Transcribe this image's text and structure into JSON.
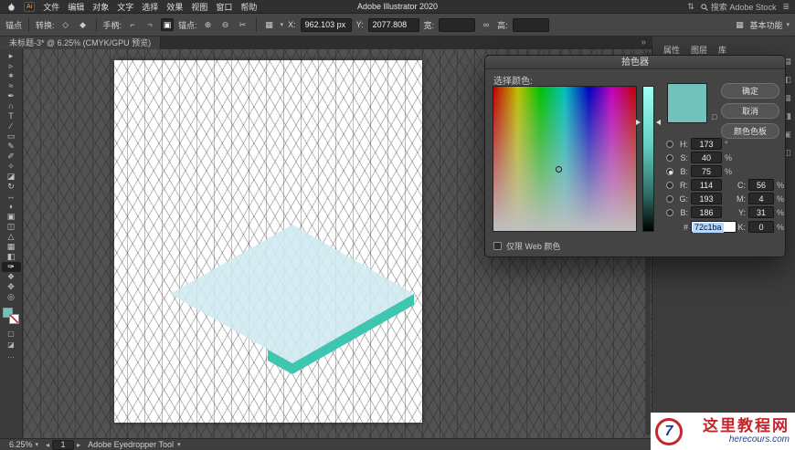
{
  "menubar": {
    "app_badge": "Ai",
    "menus": [
      "文件",
      "编辑",
      "对象",
      "文字",
      "选择",
      "效果",
      "视图",
      "窗口",
      "帮助"
    ],
    "title": "Adobe Illustrator 2020",
    "search_label": "搜索 Adobe Stock"
  },
  "control_bar": {
    "anchor_label": "锚点",
    "convert_label": "转换:",
    "handles_label": "手柄:",
    "anchors_label": "锚点:",
    "x_label": "X:",
    "x_value": "962.103 px",
    "y_label": "Y:",
    "y_value": "2077.808",
    "w_label": "宽:",
    "w_value": "",
    "h_label": "高:",
    "h_value": "",
    "workspace": "基本功能"
  },
  "document_tab": {
    "title": "未标题-3* @ 6.25% (CMYK/GPU 预览)"
  },
  "toolbar": {
    "fill_color": "#72c1ba",
    "tools": [
      {
        "name": "selection-tool",
        "glyph": "▸"
      },
      {
        "name": "direct-selection-tool",
        "glyph": "▹"
      },
      {
        "name": "magic-wand-tool",
        "glyph": "✶"
      },
      {
        "name": "lasso-tool",
        "glyph": "≈"
      },
      {
        "name": "pen-tool",
        "glyph": "✒"
      },
      {
        "name": "curvature-tool",
        "glyph": "∩"
      },
      {
        "name": "type-tool",
        "glyph": "T"
      },
      {
        "name": "line-segment-tool",
        "glyph": "∕"
      },
      {
        "name": "rectangle-tool",
        "glyph": "▭"
      },
      {
        "name": "paintbrush-tool",
        "glyph": "✎"
      },
      {
        "name": "pencil-tool",
        "glyph": "✐"
      },
      {
        "name": "shaper-tool",
        "glyph": "✧"
      },
      {
        "name": "eraser-tool",
        "glyph": "◪"
      },
      {
        "name": "rotate-tool",
        "glyph": "↻"
      },
      {
        "name": "scale-tool",
        "glyph": "↔"
      },
      {
        "name": "width-tool",
        "glyph": "◗"
      },
      {
        "name": "free-transform-tool",
        "glyph": "▣"
      },
      {
        "name": "shape-builder-tool",
        "glyph": "◫"
      },
      {
        "name": "perspective-grid-tool",
        "glyph": "△"
      },
      {
        "name": "mesh-tool",
        "glyph": "▦"
      },
      {
        "name": "gradient-tool",
        "glyph": "◧"
      },
      {
        "name": "eyedropper-tool",
        "glyph": "✑"
      },
      {
        "name": "blend-tool",
        "glyph": "❖"
      },
      {
        "name": "hand-tool",
        "glyph": "✥"
      },
      {
        "name": "zoom-tool",
        "glyph": "◎"
      }
    ]
  },
  "color_picker": {
    "title": "拾色器",
    "select_label": "选择颜色:",
    "ok": "确定",
    "cancel": "取消",
    "swatches_button": "颜色色板",
    "swatch_color": "#72c1ba",
    "h_label": "H:",
    "h_value": "173",
    "h_suffix": "°",
    "s_label": "S:",
    "s_value": "40",
    "s_suffix": "%",
    "b_label": "B:",
    "b_value": "75",
    "b_suffix": "%",
    "r_label": "R:",
    "r_value": "114",
    "g_label": "G:",
    "g_value": "193",
    "b2_label": "B:",
    "b2_value": "186",
    "hex_label": "#",
    "hex_value": "72c1ba",
    "c_label": "C:",
    "c_value": "56",
    "c_suffix": "%",
    "m_label": "M:",
    "m_value": "4",
    "m_suffix": "%",
    "y_label": "Y:",
    "y_value": "31",
    "y_suffix": "%",
    "k_label": "K:",
    "k_value": "0",
    "k_suffix": "%",
    "web_only_label": "仅限 Web 颜色"
  },
  "dock": {
    "tabs": [
      "属性",
      "图层",
      "库"
    ]
  },
  "status_bar": {
    "zoom": "6.25%",
    "artboard_number": "1",
    "tool_name": "Adobe Eyedropper Tool"
  },
  "watermark": {
    "logo": "7",
    "site_name": "这里教程网",
    "site_url": "herecours.com"
  },
  "colors": {
    "accent_teal": "#72c1ba",
    "shape_top": "#cfe9f0",
    "shape_side": "#3ec6b1"
  },
  "icons": {
    "chevron_down": "▾",
    "overflow": "»",
    "convert_corner": "◇",
    "convert_smooth": "◆",
    "handle_show": "⌐",
    "handle_hide": "¬",
    "handles_option": "▣",
    "anchor_add": "⊕",
    "anchor_remove": "⊖",
    "anchor_cut": "✂",
    "align_grid": "▦",
    "link": "∞",
    "nav_left": "◂",
    "nav_right": "▸",
    "ellipsis": "…",
    "cube": "□",
    "menu_share": "⇅",
    "menu_list": "≣",
    "dock_a": "▤",
    "dock_b": "◧",
    "dock_c": "▦",
    "dock_d": "◨",
    "dock_e": "▣",
    "dock_f": "◫",
    "draw_normal": "▢",
    "draw_behind": "◪"
  }
}
